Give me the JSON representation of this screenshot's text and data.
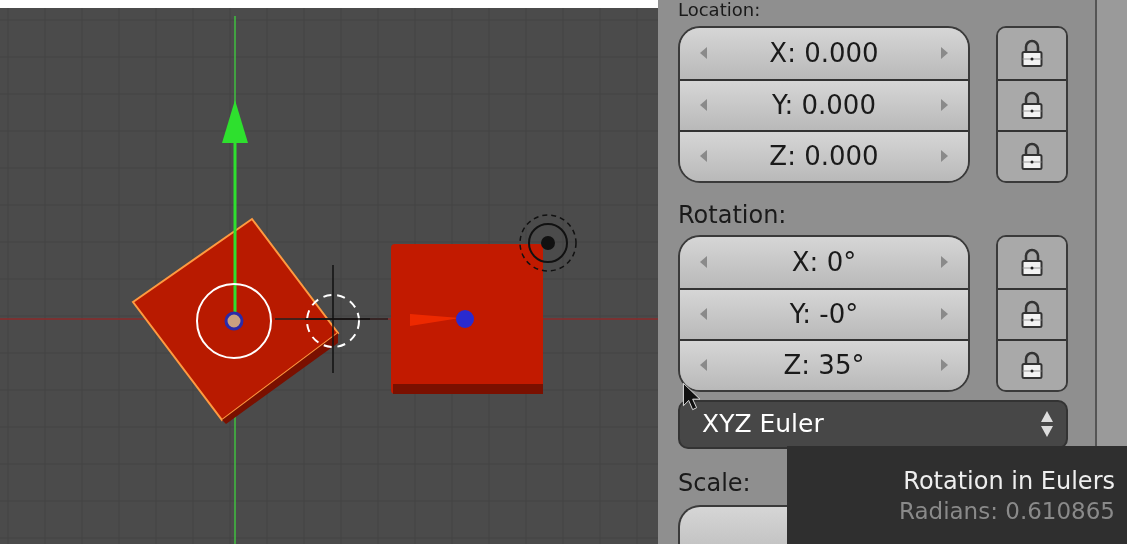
{
  "properties": {
    "location": {
      "label": "Location:",
      "fields": [
        {
          "text": "X: 0.000"
        },
        {
          "text": "Y: 0.000"
        },
        {
          "text": "Z: 0.000"
        }
      ]
    },
    "rotation": {
      "label": "Rotation:",
      "fields": [
        {
          "text": "X: 0°"
        },
        {
          "text": "Y: -0°"
        },
        {
          "text": "Z: 35°"
        }
      ],
      "mode": "XYZ Euler"
    },
    "scale": {
      "label": "Scale:"
    }
  },
  "tooltip": {
    "title": "Rotation in Eulers",
    "detail": "Radians: 0.610865"
  }
}
